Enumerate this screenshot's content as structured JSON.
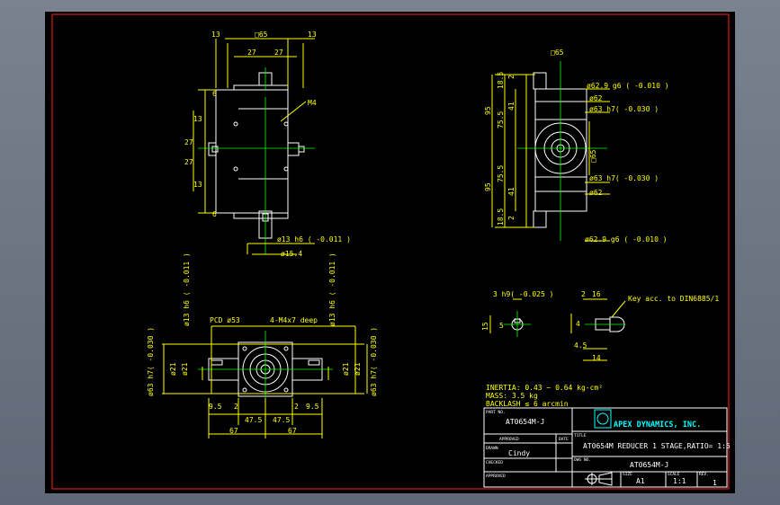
{
  "colors": {
    "background": "#000000",
    "dimension": "#ffff00",
    "outline": "#ffffff",
    "frame": "#ff2020",
    "title": "#00ffff",
    "center": "#00ff00"
  },
  "top_view": {
    "dims": {
      "sq_top": "□65",
      "left_13": "13",
      "right_13": "13",
      "d27a": "27",
      "d27b": "27",
      "v27a": "27",
      "v27b": "27",
      "v13a": "13",
      "v13b": "13",
      "v6a": "6",
      "v6b": "6",
      "m4": "M4",
      "shaft_tol": "ø13 h6 ( -0.011 )",
      "d15_4": "ø15.4"
    }
  },
  "right_view": {
    "dims": {
      "sq65": "□65",
      "sq65_side": "□65",
      "d62_9a": "ø62.9 g6 ( -0.010 )",
      "d62a": "ø62",
      "d63a": "ø63 h7( -0.030 )",
      "d63b": "ø63 h7( -0.030 )",
      "d62b": "ø62",
      "d62_9b": "ø62.9 g6 ( -0.010 )",
      "v18_5a": "18.5",
      "v2a": "2",
      "v41a": "41",
      "v75_5a": "75.5",
      "v95a": "95",
      "v95b": "95",
      "v75_5b": "75.5",
      "v41b": "41",
      "v2b": "2",
      "v18_5b": "18.5"
    }
  },
  "bottom_view": {
    "dims": {
      "pcd": "PCD ø53",
      "holes": "4-M4x7 deep",
      "h6_left": "ø13 h6 ( -0.011 )",
      "h6_right": "ø13 h6 ( -0.011 )",
      "h7_left": "ø63 h7( -0.030 )",
      "h7_right": "ø63 h7( -0.030 )",
      "d21a": "ø21",
      "d21b": "ø21",
      "d21c": "ø21",
      "d21d": "ø21",
      "v9_5a": "9.5",
      "v2a": "2",
      "v47_5a": "47.5",
      "v47_5b": "47.5",
      "v2b": "2",
      "v9_5b": "9.5",
      "v67a": "67",
      "v67b": "67"
    }
  },
  "key_details": {
    "dims": {
      "h9": "3 h9( -0.025 )",
      "k15": "15",
      "k5": "5",
      "k2": "2",
      "k16": "16",
      "key_note": "Key acc. to DIN6885/1",
      "k4": "4",
      "k45": "4.5",
      "k14": "14"
    }
  },
  "notes": {
    "inertia": "INERTIA: 0.43 ~ 0.64 kg-cm²",
    "mass": "MASS: 3.5 kg",
    "backlash": "BACKLASH ≤ 6 arcmin"
  },
  "title_block": {
    "part_no_label": "PART NO.",
    "part_no": "AT0654M-J",
    "company": "APEX DYNAMICS, INC.",
    "title_label": "TITLE",
    "title": "AT0654M REDUCER 1 STAGE,RATIO= 1:5",
    "approved_label": "APPROVED",
    "date_label": "DATE",
    "drawn_label": "DRAWN",
    "drawn_by": "Cindy",
    "checked_label": "CHECKED",
    "dwg_label": "DWG NO.",
    "dwg_no": "AT0654M-J",
    "approved2_label": "APPROVED",
    "size_label": "SIZE",
    "size": "A1",
    "scale_label": "SCALE",
    "scale": "1:1",
    "rev_label": "REV.",
    "rev": "1"
  }
}
